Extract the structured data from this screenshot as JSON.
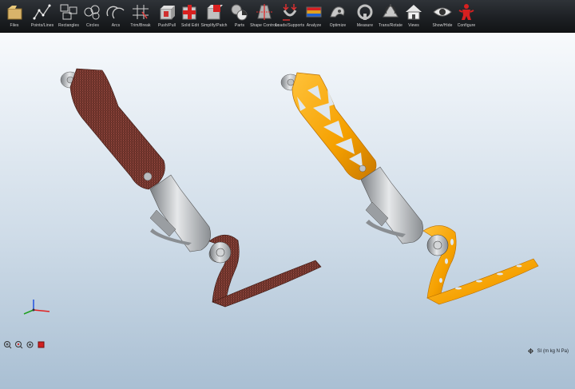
{
  "toolbar": {
    "items": [
      {
        "label": "Files",
        "icon": "files-icon"
      },
      {
        "label": "Points/Lines",
        "icon": "points-lines-icon"
      },
      {
        "label": "Rectangles",
        "icon": "rectangles-icon"
      },
      {
        "label": "Circles",
        "icon": "circles-icon"
      },
      {
        "label": "Arcs",
        "icon": "arcs-icon"
      },
      {
        "label": "Trim/Break",
        "icon": "trim-break-icon"
      },
      {
        "label": "Push/Pull",
        "icon": "push-pull-icon"
      },
      {
        "label": "Solid Edit",
        "icon": "solid-edit-icon"
      },
      {
        "label": "Simplify/Patch",
        "icon": "simplify-patch-icon"
      },
      {
        "label": "Parts",
        "icon": "parts-icon"
      },
      {
        "label": "Shape Controls",
        "icon": "shape-controls-icon"
      },
      {
        "label": "Loads/Supports",
        "icon": "loads-supports-icon"
      },
      {
        "label": "Analyze",
        "icon": "analyze-icon"
      },
      {
        "label": "Optimize",
        "icon": "optimize-icon"
      },
      {
        "label": "Measure",
        "icon": "measure-icon"
      },
      {
        "label": "Trans/Rotate",
        "icon": "trans-rotate-icon"
      },
      {
        "label": "Views",
        "icon": "views-icon"
      },
      {
        "label": "Show/Hide",
        "icon": "show-hide-icon"
      },
      {
        "label": "Configure",
        "icon": "configure-icon"
      }
    ]
  },
  "status": {
    "units": "SI (m kg N Pa)"
  },
  "colors": {
    "toolbar_bg": "#1d2024",
    "design_space": "#7a3b33",
    "optimized_part": "#f5a000",
    "metal": "#b8bcc0"
  }
}
